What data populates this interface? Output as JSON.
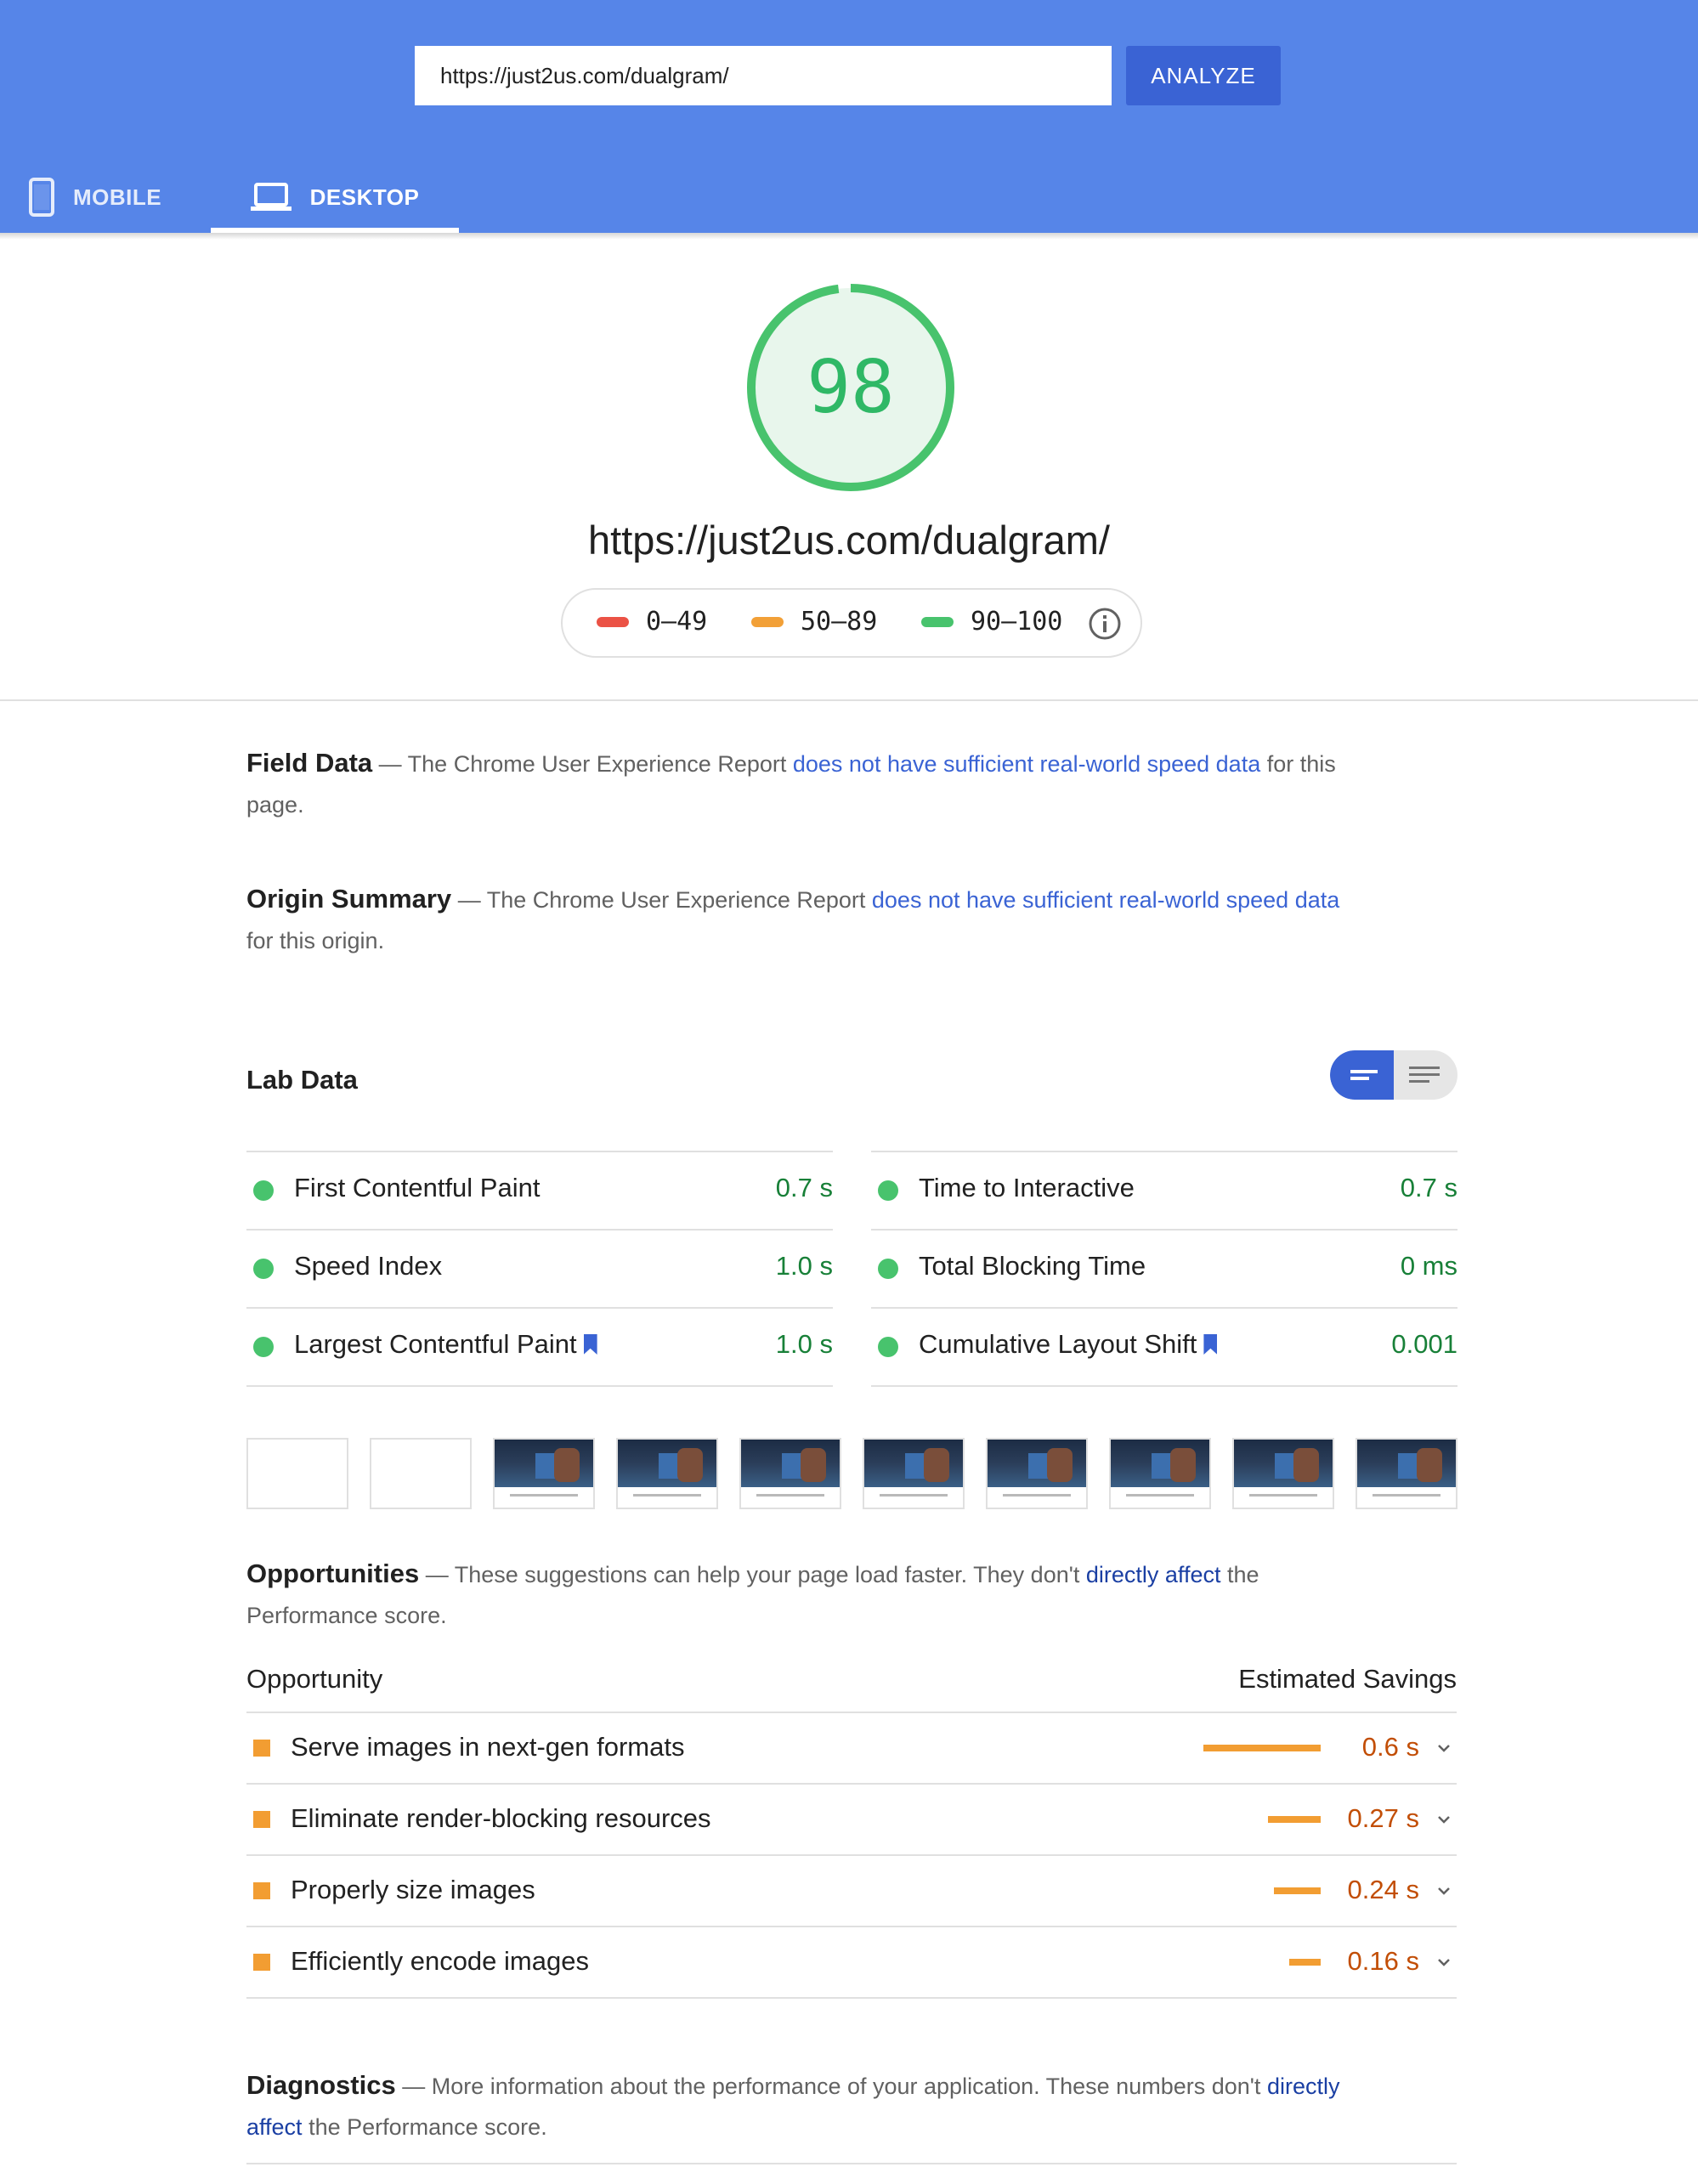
{
  "header": {
    "url_value": "https://just2us.com/dualgram/",
    "analyze_label": "ANALYZE",
    "tabs": [
      {
        "label": "MOBILE",
        "icon": "mobile-icon",
        "active": false
      },
      {
        "label": "DESKTOP",
        "icon": "laptop-icon",
        "active": true
      }
    ]
  },
  "summary": {
    "score": "98",
    "score_fraction": 0.98,
    "url": "https://just2us.com/dualgram/",
    "legend": [
      {
        "label": "0–49",
        "color": "#eb5245"
      },
      {
        "label": "50–89",
        "color": "#f2a037"
      },
      {
        "label": "90–100",
        "color": "#48c36d"
      }
    ]
  },
  "field_data": {
    "title": "Field Data",
    "text_before": " — The Chrome User Experience Report ",
    "link": "does not have sufficient real-world speed data",
    "text_after": " for this page."
  },
  "origin_summary": {
    "title": "Origin Summary",
    "text_before": " — The Chrome User Experience Report ",
    "link": "does not have sufficient real-world speed data",
    "text_after": " for this origin."
  },
  "lab_data": {
    "title": "Lab Data",
    "left_metrics": [
      {
        "name": "First Contentful Paint",
        "value": "0.7 s",
        "bookmark": false
      },
      {
        "name": "Speed Index",
        "value": "1.0 s",
        "bookmark": false
      },
      {
        "name": "Largest Contentful Paint",
        "value": "1.0 s",
        "bookmark": true
      }
    ],
    "right_metrics": [
      {
        "name": "Time to Interactive",
        "value": "0.7 s",
        "bookmark": false
      },
      {
        "name": "Total Blocking Time",
        "value": "0 ms",
        "bookmark": false
      },
      {
        "name": "Cumulative Layout Shift",
        "value": "0.001",
        "bookmark": true
      }
    ]
  },
  "filmstrip": {
    "frames": [
      "blank",
      "blank",
      "page",
      "page",
      "page",
      "page",
      "page",
      "page",
      "page",
      "page"
    ]
  },
  "opportunities": {
    "title": "Opportunities",
    "text_before": " — These suggestions can help your page load faster. They don't ",
    "link": "directly affect",
    "text_after": " the Performance score.",
    "col_opportunity": "Opportunity",
    "col_savings": "Estimated Savings",
    "items": [
      {
        "name": "Serve images in next-gen formats",
        "value": "0.6 s",
        "savings_s": 0.6
      },
      {
        "name": "Eliminate render-blocking resources",
        "value": "0.27 s",
        "savings_s": 0.27
      },
      {
        "name": "Properly size images",
        "value": "0.24 s",
        "savings_s": 0.24
      },
      {
        "name": "Efficiently encode images",
        "value": "0.16 s",
        "savings_s": 0.16
      }
    ]
  },
  "diagnostics": {
    "title": "Diagnostics",
    "text_before": " — More information about the performance of your application. These numbers don't ",
    "link": "directly affect",
    "text_after": " the Performance score."
  }
}
